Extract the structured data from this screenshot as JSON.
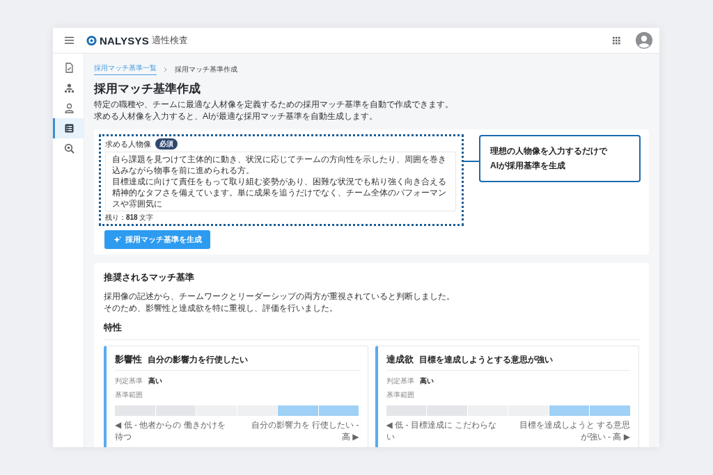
{
  "header": {
    "brand": "NALYSYS",
    "product": "適性検査"
  },
  "sidebar": {
    "items": [
      {
        "kind": "document",
        "selected": false
      },
      {
        "kind": "team",
        "selected": false
      },
      {
        "kind": "person",
        "selected": false
      },
      {
        "kind": "list",
        "selected": true
      },
      {
        "kind": "search",
        "selected": false
      }
    ]
  },
  "breadcrumb": [
    {
      "label": "採用マッチ基準一覧",
      "link": true
    },
    {
      "label": "採用マッチ基準作成",
      "link": false
    }
  ],
  "page": {
    "title": "採用マッチ基準作成",
    "description": [
      "特定の職種や、チームに最適な人材像を定義するための採用マッチ基準を自動で作成できます。",
      "求める人材像を入力すると、AIが最適な採用マッチ基準を自動生成します。"
    ]
  },
  "form": {
    "label": "求める人物像",
    "badge": "必須",
    "value_lines": [
      "自ら課題を見つけて主体的に動き、状況に応じてチームの方向性を示したり、周囲を巻き込みながら物事を前に進められる方。",
      "目標達成に向けて責任をもって取り組む姿勢があり、困難な状況でも粘り強く向き合える精神的なタフさを備えています。単に成果を追うだけでなく、チーム全体のパフォーマンスや雰囲気に"
    ],
    "remaining": "残り：**818** 文字",
    "button": "採用マッチ基準を生成"
  },
  "callout": {
    "lines": [
      "理想の人物像を入力するだけで",
      "AIが採用基準を生成"
    ]
  },
  "recommendation": {
    "title": "推奨されるマッチ基準",
    "text": [
      "採用像の記述から、チームワークとリーダーシップの両方が重視されていると判断しました。",
      "そのため、影響性と達成欲を特に重視し、評価を行いました。"
    ],
    "section": "特性",
    "traits": [
      {
        "name": "影響性",
        "tagline": "自分の影響力を行使したい",
        "judge_label": "判定基準",
        "judge_value": "高い",
        "range_label": "基準範囲",
        "segments": [
          {
            "selected": false
          },
          {
            "selected": false
          },
          {
            "selected": false
          },
          {
            "selected": false
          },
          {
            "selected": true
          },
          {
            "selected": true
          }
        ],
        "low_label": "◀ 低 - 他者からの 働きかけを待つ",
        "high_label": "自分の影響力を 行使したい - 高 ▶"
      },
      {
        "name": "達成欲",
        "tagline": "目標を達成しようとする意思が強い",
        "judge_label": "判定基準",
        "judge_value": "高い",
        "range_label": "基準範囲",
        "segments": [
          {
            "selected": false
          },
          {
            "selected": false
          },
          {
            "selected": false
          },
          {
            "selected": false
          },
          {
            "selected": true
          },
          {
            "selected": true
          }
        ],
        "low_label": "◀ 低 - 目標達成に こだわらない",
        "high_label": "目標を達成しようと する意思が強い - 高 ▶"
      }
    ]
  }
}
